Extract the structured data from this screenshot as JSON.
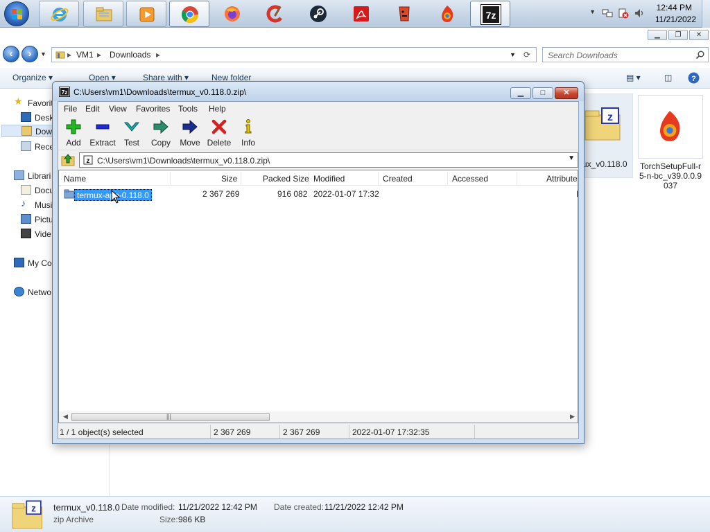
{
  "taskbar": {
    "apps": [
      {
        "name": "internet-explorer-icon"
      },
      {
        "name": "file-explorer-icon"
      },
      {
        "name": "media-player-icon"
      },
      {
        "name": "chrome-icon"
      },
      {
        "name": "firefox-icon"
      },
      {
        "name": "ccleaner-icon"
      },
      {
        "name": "steam-icon"
      },
      {
        "name": "acrobat-icon"
      },
      {
        "name": "unknown-app-icon"
      },
      {
        "name": "torch-icon"
      },
      {
        "name": "sevenzip-icon",
        "label": "7z"
      }
    ],
    "clock": {
      "time": "12:44 PM",
      "date": "11/21/2022"
    }
  },
  "explorer": {
    "breadcrumb": [
      "VM1",
      "Downloads"
    ],
    "search_placeholder": "Search Downloads",
    "toolbar": {
      "organize": "Organize",
      "open": "Open",
      "share_with": "Share with",
      "new_folder": "New folder"
    },
    "nav": {
      "favorites": "Favorit",
      "desktop": "Deskt",
      "downloads": "Dow",
      "recent": "Rece",
      "libraries": "Librari",
      "documents": "Docu",
      "music": "Musi",
      "pictures": "Pictu",
      "videos": "Vide",
      "computer": "My Co",
      "network": "Netwo"
    },
    "files": [
      {
        "label": "ux_v0.118.0"
      },
      {
        "label": "TorchSetupFull-r5-n-bc_v39.0.0.9037"
      }
    ],
    "details": {
      "name": "termux_v0.118.0",
      "type": "zip Archive",
      "modified_label": "Date modified:",
      "modified": "11/21/2022 12:42 PM",
      "created_label": "Date created:",
      "created": "11/21/2022 12:42 PM",
      "size_label": "Size:",
      "size": "986 KB"
    }
  },
  "sevenzip": {
    "title": "C:\\Users\\vm1\\Downloads\\termux_v0.118.0.zip\\",
    "app_icon_label": "7z",
    "menu": [
      "File",
      "Edit",
      "View",
      "Favorites",
      "Tools",
      "Help"
    ],
    "tools": [
      {
        "label": "Add",
        "icon": "add-icon",
        "color": "#22b422"
      },
      {
        "label": "Extract",
        "icon": "extract-icon",
        "color": "#1f2bd0"
      },
      {
        "label": "Test",
        "icon": "test-icon",
        "color": "#1aa8a8"
      },
      {
        "label": "Copy",
        "icon": "copy-icon",
        "color": "#2d8a6a"
      },
      {
        "label": "Move",
        "icon": "move-icon",
        "color": "#1b2c8c"
      },
      {
        "label": "Delete",
        "icon": "delete-icon",
        "color": "#d61f1f"
      },
      {
        "label": "Info",
        "icon": "info-icon",
        "color": "#e2c400"
      }
    ],
    "path": "C:\\Users\\vm1\\Downloads\\termux_v0.118.0.zip\\",
    "columns": [
      "Name",
      "Size",
      "Packed Size",
      "Modified",
      "Created",
      "Accessed",
      "Attribute"
    ],
    "rows": [
      {
        "name": "termux-app-0.118.0",
        "size": "2 367 269",
        "packed": "916 082",
        "modified": "2022-01-07 17:32",
        "created": "",
        "accessed": "",
        "attr": "I"
      }
    ],
    "status": {
      "selection": "1 / 1 object(s) selected",
      "size": "2 367 269",
      "packed": "2 367 269",
      "modified": "2022-01-07 17:32:35"
    }
  }
}
